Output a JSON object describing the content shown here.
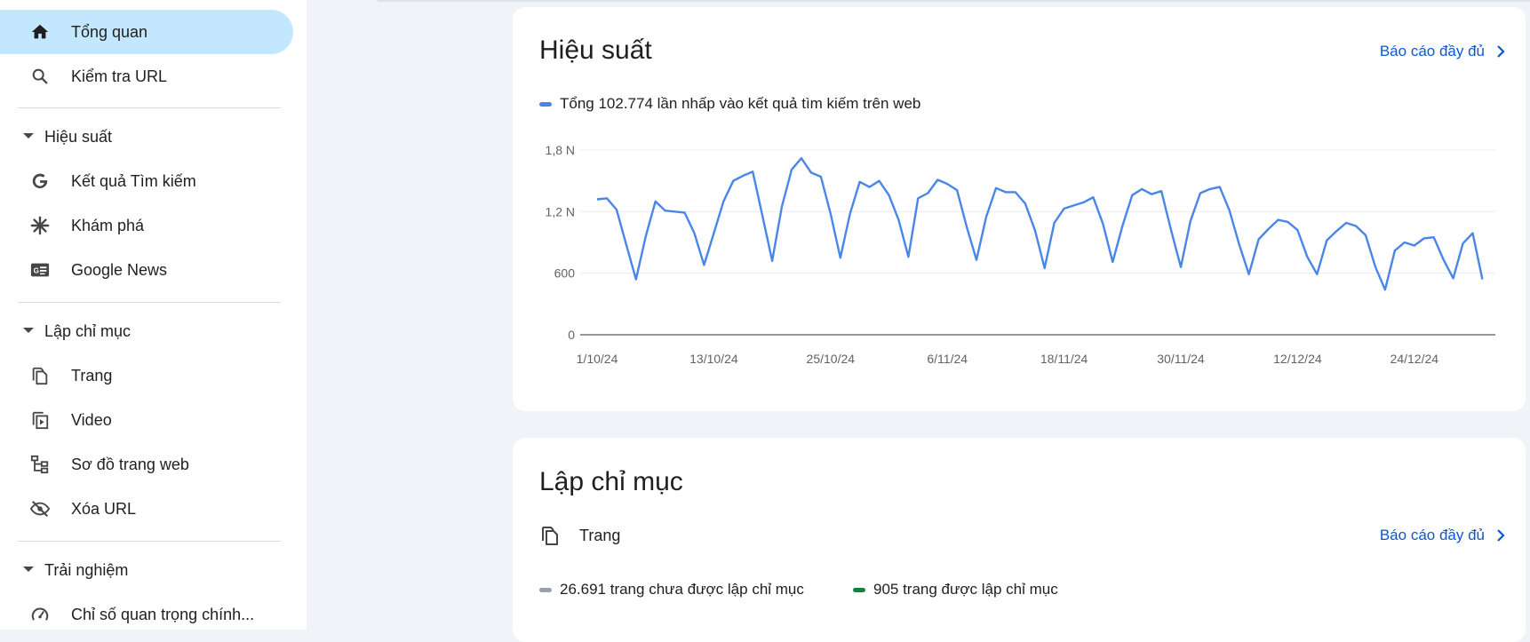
{
  "sidebar": {
    "items": [
      {
        "label": "Tổng quan",
        "icon": "home-icon",
        "active": true
      },
      {
        "label": "Kiểm tra URL",
        "icon": "search-icon"
      }
    ],
    "sections": [
      {
        "label": "Hiệu suất",
        "items": [
          {
            "label": "Kết quả Tìm kiếm",
            "icon": "google-g-icon"
          },
          {
            "label": "Khám phá",
            "icon": "asterisk-icon"
          },
          {
            "label": "Google News",
            "icon": "google-news-icon"
          }
        ]
      },
      {
        "label": "Lập chỉ mục",
        "items": [
          {
            "label": "Trang",
            "icon": "pages-icon"
          },
          {
            "label": "Video",
            "icon": "video-pages-icon"
          },
          {
            "label": "Sơ đồ trang web",
            "icon": "sitemap-icon"
          },
          {
            "label": "Xóa URL",
            "icon": "eye-off-icon"
          }
        ]
      },
      {
        "label": "Trải nghiệm",
        "items": [
          {
            "label": "Chỉ số quan trọng chính...",
            "icon": "speedometer-icon"
          }
        ]
      }
    ]
  },
  "performance": {
    "title": "Hiệu suất",
    "full_report": "Báo cáo đầy đủ",
    "legend": "Tổng 102.774 lần nhấp vào kết quả tìm kiếm trên web",
    "line_color": "#4a86e8"
  },
  "chart_data": {
    "type": "line",
    "title": "",
    "xlabel": "",
    "ylabel": "",
    "ylim": [
      0,
      1800
    ],
    "y_ticks": [
      0,
      600,
      1200,
      1800
    ],
    "y_tick_labels": [
      "0",
      "600",
      "1,2 N",
      "1,8 N"
    ],
    "x_tick_labels": [
      "1/10/24",
      "13/10/24",
      "25/10/24",
      "6/11/24",
      "18/11/24",
      "30/11/24",
      "12/12/24",
      "24/12/24"
    ],
    "x_tick_day_index": [
      0,
      12,
      24,
      36,
      48,
      60,
      72,
      84
    ],
    "grid": true,
    "series": [
      {
        "name": "Tổng 102.774 lần nhấp vào kết quả tìm kiếm trên web",
        "values": [
          1320,
          1330,
          1220,
          880,
          540,
          960,
          1300,
          1210,
          1200,
          1190,
          990,
          680,
          990,
          1300,
          1500,
          1550,
          1590,
          1160,
          720,
          1250,
          1610,
          1720,
          1580,
          1540,
          1180,
          750,
          1180,
          1490,
          1440,
          1500,
          1360,
          1120,
          760,
          1330,
          1380,
          1510,
          1470,
          1410,
          1050,
          730,
          1150,
          1430,
          1390,
          1390,
          1280,
          1020,
          650,
          1090,
          1230,
          1260,
          1290,
          1340,
          1080,
          710,
          1060,
          1360,
          1420,
          1370,
          1400,
          1020,
          660,
          1110,
          1380,
          1420,
          1440,
          1210,
          880,
          590,
          930,
          1030,
          1120,
          1100,
          1020,
          760,
          590,
          920,
          1010,
          1090,
          1060,
          970,
          660,
          440,
          820,
          900,
          870,
          940,
          950,
          730,
          550,
          890,
          990,
          540
        ]
      }
    ]
  },
  "indexing": {
    "title": "Lập chỉ mục",
    "page_label": "Trang",
    "full_report": "Báo cáo đầy đủ",
    "not_indexed": "26.691 trang chưa được lập chỉ mục",
    "indexed": "905 trang được lập chỉ mục",
    "not_indexed_color": "#9aa0a6",
    "indexed_color": "#188038"
  }
}
